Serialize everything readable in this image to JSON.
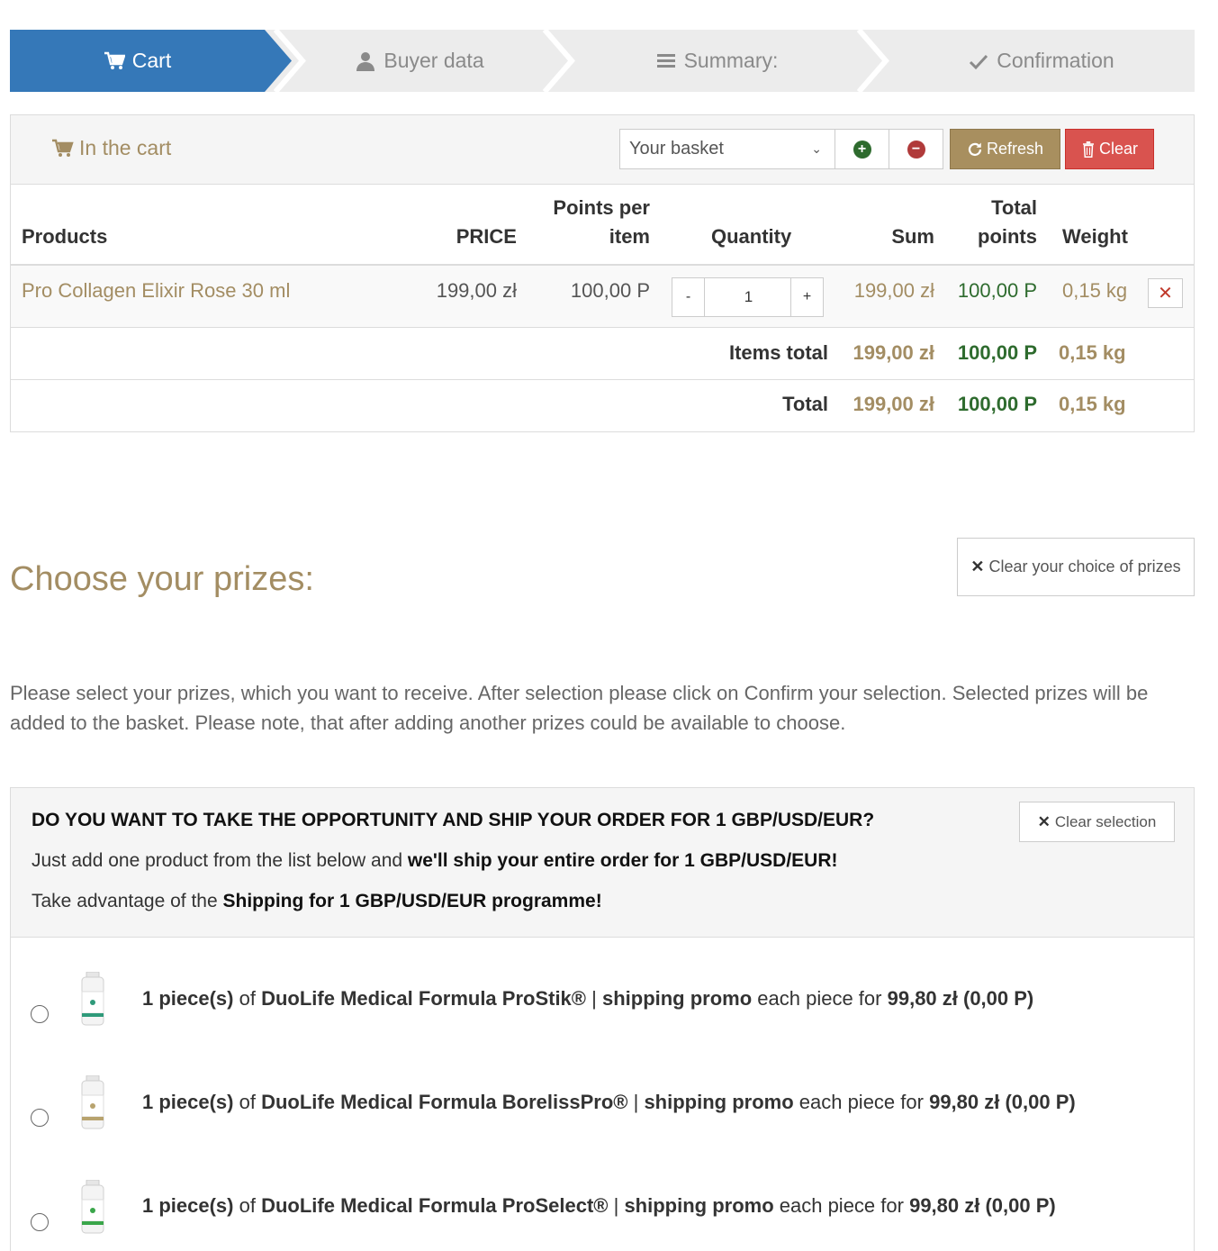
{
  "stepper": {
    "steps": [
      {
        "label": "Cart",
        "icon": "cart-icon",
        "active": true
      },
      {
        "label": "Buyer data",
        "icon": "user-icon",
        "active": false
      },
      {
        "label": "Summary:",
        "icon": "list-icon",
        "active": false
      },
      {
        "label": "Confirmation",
        "icon": "check-icon",
        "active": false
      }
    ],
    "active_color": "#3578b8"
  },
  "cart": {
    "title": "In the cart",
    "basket_select": {
      "value": "Your basket"
    },
    "refresh_label": "Refresh",
    "clear_label": "Clear",
    "columns": {
      "products": "Products",
      "price": "PRICE",
      "points_l1": "Points per",
      "points_l2": "item",
      "quantity": "Quantity",
      "sum": "Sum",
      "total_points_l1": "Total",
      "total_points_l2": "points",
      "weight": "Weight"
    },
    "items": [
      {
        "name": "Pro Collagen Elixir Rose 30 ml",
        "price": "199,00 zł",
        "points": "100,00 P",
        "quantity": "1",
        "sum": "199,00 zł",
        "total_points": "100,00 P",
        "weight": "0,15 kg"
      }
    ],
    "qty_minus": "-",
    "qty_plus": "+",
    "remove": "✕",
    "items_total": {
      "label": "Items total",
      "sum": "199,00 zł",
      "points": "100,00 P",
      "weight": "0,15 kg"
    },
    "total": {
      "label": "Total",
      "sum": "199,00 zł",
      "points": "100,00 P",
      "weight": "0,15 kg"
    }
  },
  "prizes": {
    "title": "Choose your prizes:",
    "clear_choice_label": "Clear your choice of prizes",
    "intro": "Please select your prizes, which you want to receive. After selection please click on Confirm your selection. Selected prizes will be added to the basket. Please note, that after adding another prizes could be available to choose.",
    "promo": {
      "question": "DO YOU WANT TO TAKE THE OPPORTUNITY AND SHIP YOUR ORDER FOR 1 GBP/USD/EUR?",
      "line1_a": "Just add one product from the list below and ",
      "line1_b": "we'll ship your entire order for 1 GBP/USD/EUR!",
      "line2_a": "Take advantage of the ",
      "line2_b": "Shipping for 1 GBP/USD/EUR programme!",
      "clear_selection_label": "Clear selection"
    },
    "options": [
      {
        "qty": "1 piece(s)",
        "of": " of ",
        "name": "DuoLife Medical Formula ProStik®",
        "sep": " | ",
        "promo": "shipping promo",
        "each": " each piece for ",
        "price": "99,80 zł (0,00 P)"
      },
      {
        "qty": "1 piece(s)",
        "of": " of ",
        "name": "DuoLife Medical Formula BorelissPro®",
        "sep": " | ",
        "promo": "shipping promo",
        "each": " each piece for ",
        "price": "99,80 zł (0,00 P)"
      },
      {
        "qty": "1 piece(s)",
        "of": " of ",
        "name": "DuoLife Medical Formula ProSelect®",
        "sep": " | ",
        "promo": "shipping promo",
        "each": " each piece for ",
        "price": "99,80 zł (0,00 P)"
      }
    ]
  },
  "colors": {
    "gold": "#a38d63",
    "green": "#2e6b2e",
    "danger": "#d9534f",
    "refresh": "#a88f5f"
  }
}
